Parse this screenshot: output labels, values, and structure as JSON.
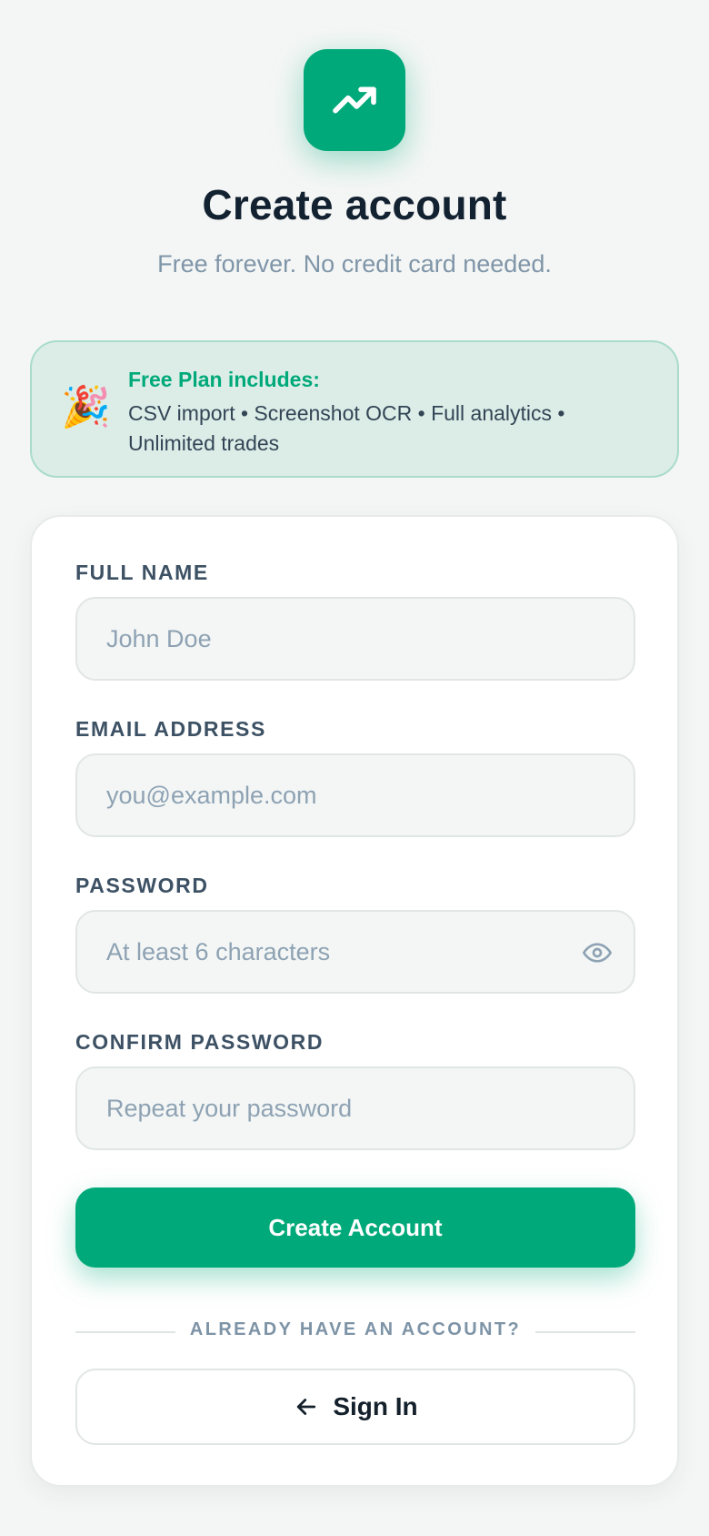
{
  "header": {
    "logo_icon": "trending-up-icon",
    "title": "Create account",
    "subtitle": "Free forever. No credit card needed."
  },
  "plan_banner": {
    "emoji": "🎉",
    "heading": "Free Plan includes:",
    "features": "CSV import • Screenshot OCR • Full analytics • Unlimited trades"
  },
  "form": {
    "full_name": {
      "label": "FULL NAME",
      "placeholder": "John Doe",
      "value": ""
    },
    "email": {
      "label": "EMAIL ADDRESS",
      "placeholder": "you@example.com",
      "value": ""
    },
    "password": {
      "label": "PASSWORD",
      "placeholder": "At least 6 characters",
      "value": "",
      "toggle_icon": "eye-icon"
    },
    "confirm_password": {
      "label": "CONFIRM PASSWORD",
      "placeholder": "Repeat your password",
      "value": ""
    },
    "submit_label": "Create Account"
  },
  "footer": {
    "divider_text": "ALREADY HAVE AN ACCOUNT?",
    "signin_label": "Sign In",
    "signin_icon": "arrow-left-icon"
  },
  "colors": {
    "accent": "#00a979",
    "background": "#f4f6f5",
    "banner_bg": "#dcede8",
    "title": "#132231",
    "muted": "#7f95a8"
  }
}
